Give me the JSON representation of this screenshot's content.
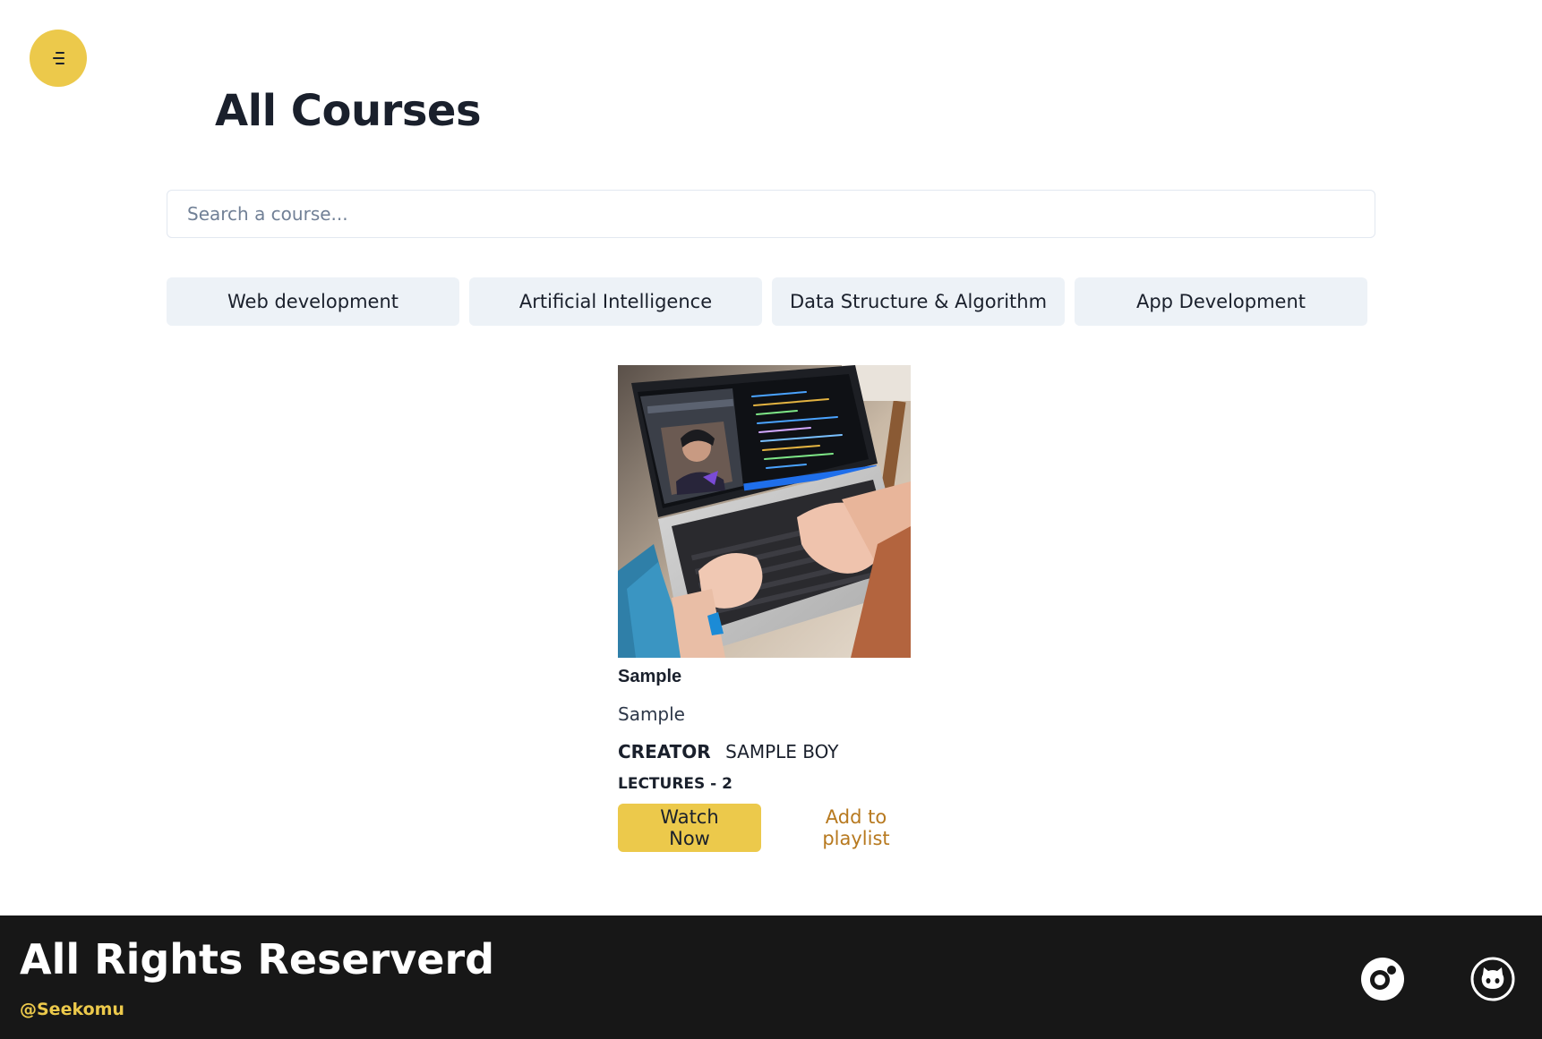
{
  "menu": {
    "icon": "hamburger-menu-icon"
  },
  "page_title": "All Courses",
  "search": {
    "placeholder": "Search a course...",
    "value": ""
  },
  "categories": [
    "Web development",
    "Artificial Intelligence",
    "Data Structure & Algorithm",
    "App Development"
  ],
  "course": {
    "image": "laptop-coding-photo",
    "title": "Sample",
    "description": "Sample",
    "creator_label": "CREATOR",
    "creator_name": "SAMPLE BOY",
    "lectures": "LECTURES - 2",
    "watch_label": "Watch Now",
    "playlist_label": "Add to playlist"
  },
  "footer": {
    "title": "All Rights Reserverd",
    "handle": "@Seekomu",
    "social_icons": [
      "dribbble-icon",
      "github-icon"
    ]
  },
  "colors": {
    "accent": "#ecc94b",
    "footer_bg": "#171717",
    "link": "#b7791f",
    "category_bg": "#edf2f7"
  }
}
